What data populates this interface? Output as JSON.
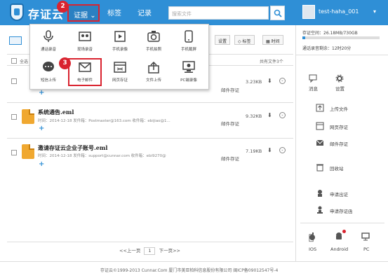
{
  "header": {
    "brand": "存证云",
    "nav": {
      "evidence": "证据",
      "tags": "标签",
      "records": "记录"
    },
    "search_placeholder": "搜索文件",
    "username": "test-haha_001",
    "step_badges": [
      "2",
      "3"
    ]
  },
  "dropdown": {
    "items": [
      {
        "label": "通话录音",
        "icon": "microphone-icon"
      },
      {
        "label": "现场录音",
        "icon": "cassette-icon"
      },
      {
        "label": "手机录像",
        "icon": "film-icon"
      },
      {
        "label": "手机拍照",
        "icon": "camera-icon"
      },
      {
        "label": "手机截屏",
        "icon": "phone-icon"
      },
      {
        "label": "短信上传",
        "icon": "chat-icon"
      },
      {
        "label": "电子邮件",
        "icon": "mail-icon"
      },
      {
        "label": "网页存证",
        "icon": "browser-icon"
      },
      {
        "label": "文件上传",
        "icon": "upload-icon"
      },
      {
        "label": "PC端录像",
        "icon": "monitor-icon"
      }
    ]
  },
  "toolbar": {
    "settings": "设置",
    "tags": "标签",
    "time": "时间",
    "select_all": "全选",
    "total": "共有文件3个"
  },
  "storage": {
    "label": "存证空间：26.18MB/730GB",
    "used_fraction": 0.036,
    "validity": "通话录音剩余：12时20分"
  },
  "files": [
    {
      "name": "",
      "meta": "",
      "status": "邮件存证",
      "size": "3.23KB"
    },
    {
      "name": "系统通告.eml",
      "meta": "时间：2014-12-18 发件箱：Postmaster@163.com 收件箱：ebijiao@1...",
      "status": "邮件存证",
      "size": "9.32KB"
    },
    {
      "name": "邀请存证云企业子账号.eml",
      "meta": "时间：2014-12-18 发件箱：support@cunnar.com 收件箱：ebi9270@",
      "status": "邮件存证",
      "size": "7.19KB"
    }
  ],
  "right_panel": {
    "messages": "消息",
    "settings": "设置",
    "upload": "上传文件",
    "web": "网页存证",
    "mail": "邮件存证",
    "trash": "回收站",
    "apply_cert": "申请出证",
    "apply_notary": "申请存证函",
    "platforms": [
      "IOS",
      "Android",
      "PC"
    ]
  },
  "pager": {
    "prev": "<<上一页",
    "page": "1",
    "next": "下一页>>"
  },
  "footer": "存证云©1999-2013 Cunnar.Com 厦门市美亚柏科信息股份有限公司 闽ICP备09012547号-4",
  "colors": {
    "header": "#2f8fd6",
    "highlight": "#d9232f"
  }
}
